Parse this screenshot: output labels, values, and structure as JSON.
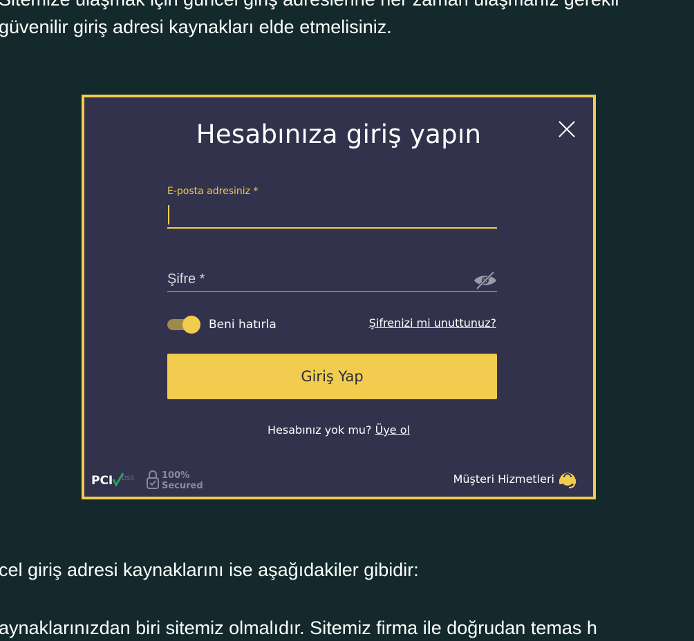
{
  "article": {
    "line_top_clipped": "Sitemize ulaşmak için güncel giriş adreslerine her zaman ulaşmanız gerekir",
    "line_top": "güvenilir giriş adresi kaynakları elde etmelisiniz.",
    "line_mid": "cel giriş adresi kaynaklarını ise aşağıdakiler gibidir:",
    "line_bottom": "aynaklarınızdan biri sitemiz olmalıdır. Sitemiz firma ile doğrudan temas h"
  },
  "modal": {
    "title": "Hesabınıza giriş yapın",
    "close_icon": "close-icon",
    "email": {
      "label": "E-posta adresiniz *",
      "value": ""
    },
    "password": {
      "placeholder": "Şifre *",
      "value": "",
      "icon": "eye-slash-icon"
    },
    "remember": {
      "label": "Beni hatırla",
      "checked": true
    },
    "forgot_link": "Şifrenizi mi unuttunuz?",
    "login_button": "Giriş Yap",
    "signup": {
      "prompt": "Hesabınız yok mu?",
      "link": "Üye ol"
    },
    "footer": {
      "pci_text": "PCI",
      "pci_sub": "DSS",
      "secured_percent": "100%",
      "secured_text": "Secured",
      "support_label": "Müşteri Hizmetleri",
      "support_icon": "headset-icon"
    }
  },
  "colors": {
    "page_bg": "#13292b",
    "modal_bg": "#33324c",
    "accent": "#f1cc4f"
  }
}
